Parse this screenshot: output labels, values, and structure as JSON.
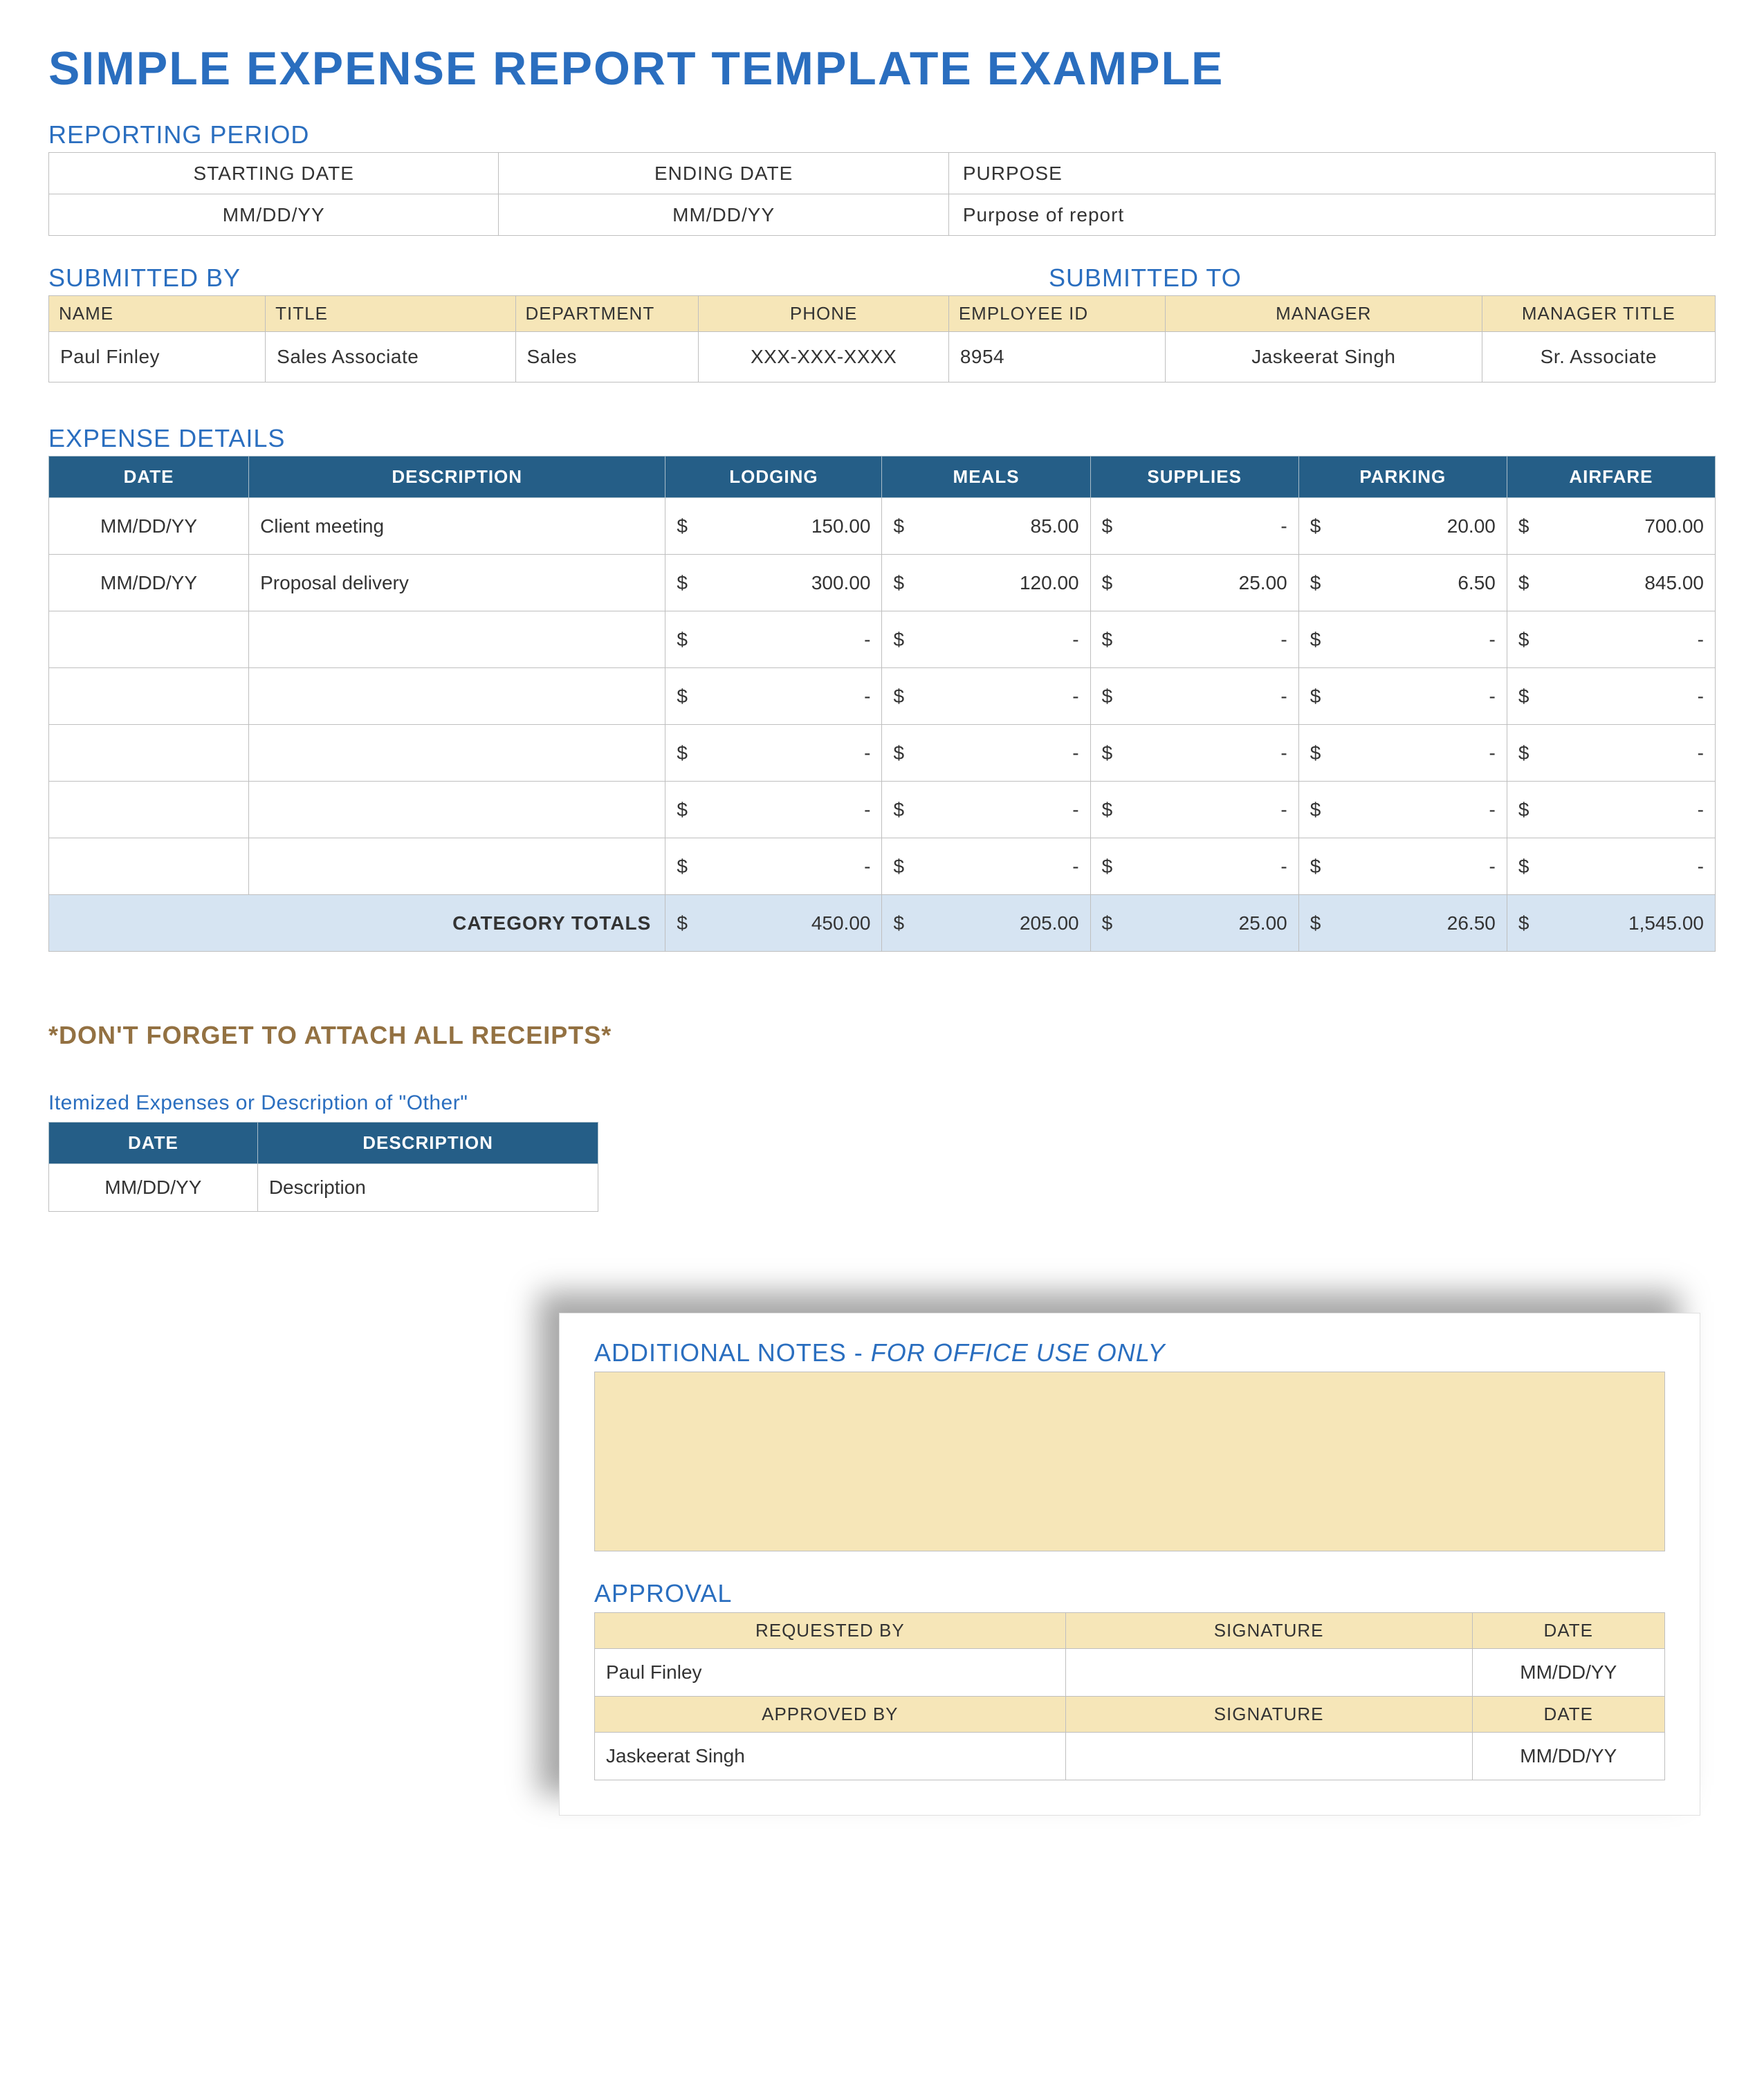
{
  "title": "SIMPLE EXPENSE REPORT TEMPLATE EXAMPLE",
  "sections": {
    "reporting_period": "REPORTING PERIOD",
    "submitted_by": "SUBMITTED BY",
    "submitted_to": "SUBMITTED TO",
    "expense_details": "EXPENSE DETAILS",
    "receipts_note": "*DON'T FORGET TO ATTACH ALL RECEIPTS*",
    "itemized_label": "Itemized Expenses or Description of \"Other\"",
    "additional_notes": "ADDITIONAL NOTES - ",
    "additional_notes_ital": "FOR OFFICE USE ONLY",
    "approval": "APPROVAL"
  },
  "reporting_period": {
    "headers": {
      "start": "STARTING DATE",
      "end": "ENDING DATE",
      "purpose": "PURPOSE"
    },
    "values": {
      "start": "MM/DD/YY",
      "end": "MM/DD/YY",
      "purpose": "Purpose of report"
    }
  },
  "submitted": {
    "headers": {
      "name": "NAME",
      "title": "TITLE",
      "department": "DEPARTMENT",
      "phone": "PHONE",
      "employee_id": "EMPLOYEE ID",
      "manager": "MANAGER",
      "manager_title": "MANAGER TITLE"
    },
    "values": {
      "name": "Paul Finley",
      "title": "Sales Associate",
      "department": "Sales",
      "phone": "XXX-XXX-XXXX",
      "employee_id": "8954",
      "manager": "Jaskeerat Singh",
      "manager_title": "Sr. Associate"
    }
  },
  "expense": {
    "headers": {
      "date": "DATE",
      "description": "DESCRIPTION",
      "lodging": "LODGING",
      "meals": "MEALS",
      "supplies": "SUPPLIES",
      "parking": "PARKING",
      "airfare": "AIRFARE"
    },
    "currency": "$",
    "rows": [
      {
        "date": "MM/DD/YY",
        "desc": "Client meeting",
        "lodging": "150.00",
        "meals": "85.00",
        "supplies": "-",
        "parking": "20.00",
        "airfare": "700.00"
      },
      {
        "date": "MM/DD/YY",
        "desc": "Proposal delivery",
        "lodging": "300.00",
        "meals": "120.00",
        "supplies": "25.00",
        "parking": "6.50",
        "airfare": "845.00"
      },
      {
        "date": "",
        "desc": "",
        "lodging": "-",
        "meals": "-",
        "supplies": "-",
        "parking": "-",
        "airfare": "-"
      },
      {
        "date": "",
        "desc": "",
        "lodging": "-",
        "meals": "-",
        "supplies": "-",
        "parking": "-",
        "airfare": "-"
      },
      {
        "date": "",
        "desc": "",
        "lodging": "-",
        "meals": "-",
        "supplies": "-",
        "parking": "-",
        "airfare": "-"
      },
      {
        "date": "",
        "desc": "",
        "lodging": "-",
        "meals": "-",
        "supplies": "-",
        "parking": "-",
        "airfare": "-"
      },
      {
        "date": "",
        "desc": "",
        "lodging": "-",
        "meals": "-",
        "supplies": "-",
        "parking": "-",
        "airfare": "-"
      }
    ],
    "totals_label": "CATEGORY TOTALS",
    "totals": {
      "lodging": "450.00",
      "meals": "205.00",
      "supplies": "25.00",
      "parking": "26.50",
      "airfare": "1,545.00"
    }
  },
  "itemized": {
    "headers": {
      "date": "DATE",
      "description": "DESCRIPTION"
    },
    "rows": [
      {
        "date": "MM/DD/YY",
        "desc": "Description"
      }
    ]
  },
  "approval": {
    "headers": {
      "requested_by": "REQUESTED BY",
      "signature": "SIGNATURE",
      "date": "DATE",
      "approved_by": "APPROVED BY"
    },
    "requested": {
      "name": "Paul Finley",
      "signature": "",
      "date": "MM/DD/YY"
    },
    "approved": {
      "name": "Jaskeerat Singh",
      "signature": "",
      "date": "MM/DD/YY"
    }
  }
}
